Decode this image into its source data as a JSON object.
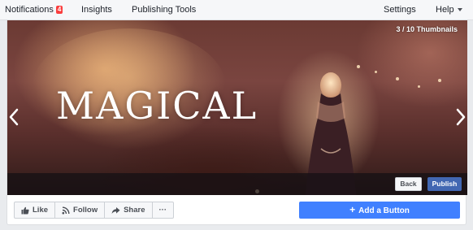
{
  "nav": {
    "notifications_label": "Notifications",
    "notifications_count": "4",
    "insights_label": "Insights",
    "publishing_tools_label": "Publishing Tools",
    "settings_label": "Settings",
    "help_label": "Help"
  },
  "cover": {
    "title": "MAGICAL",
    "thumbnail_counter": "3 / 10 Thumbnails",
    "back_label": "Back",
    "publish_label": "Publish"
  },
  "actions": {
    "like_label": "Like",
    "follow_label": "Follow",
    "share_label": "Share",
    "more_label": "···",
    "add_button_label": "Add a Button"
  },
  "colors": {
    "badge": "#fa3e3e",
    "publish_button": "#4267b2",
    "add_button": "#4080ff"
  }
}
